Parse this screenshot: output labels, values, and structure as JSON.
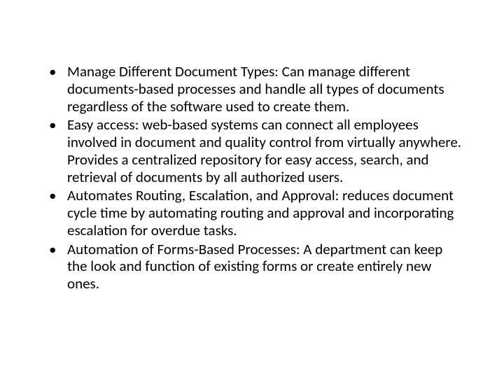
{
  "bullets": [
    "Manage Different Document Types: Can manage different documents-based processes and handle all types of documents regardless of the software used to create them.",
    "Easy access: web-based systems can connect all employees involved in document and quality control from virtually anywhere. Provides a centralized repository for easy access, search, and retrieval of documents by all authorized users.",
    "Automates Routing, Escalation, and Approval: reduces document cycle time by automating routing and approval and incorporating escalation for overdue tasks.",
    "Automation of Forms-Based Processes: A department can keep the look and function of existing forms or create entirely new ones."
  ]
}
